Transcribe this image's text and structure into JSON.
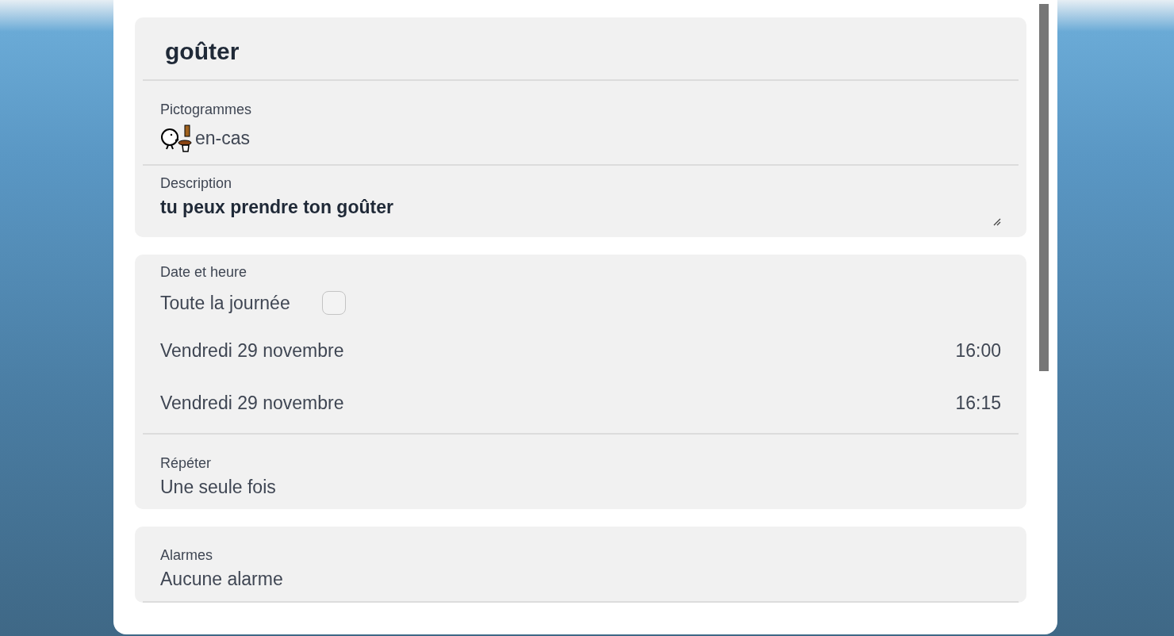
{
  "title": "goûter",
  "pictograms": {
    "label": "Pictogrammes",
    "items": [
      {
        "name": "en-cas"
      }
    ]
  },
  "description": {
    "label": "Description",
    "value": "tu peux prendre ton goûter"
  },
  "date_time": {
    "label": "Date et heure",
    "all_day": {
      "label": "Toute la journée",
      "checked": false
    },
    "rows": [
      {
        "date": "Vendredi 29 novembre",
        "time": "16:00"
      },
      {
        "date": "Vendredi 29 novembre",
        "time": "16:15"
      }
    ]
  },
  "repeat": {
    "label": "Répéter",
    "value": "Une seule fois"
  },
  "alarms": {
    "label": "Alarmes",
    "value": "Aucune alarme"
  }
}
